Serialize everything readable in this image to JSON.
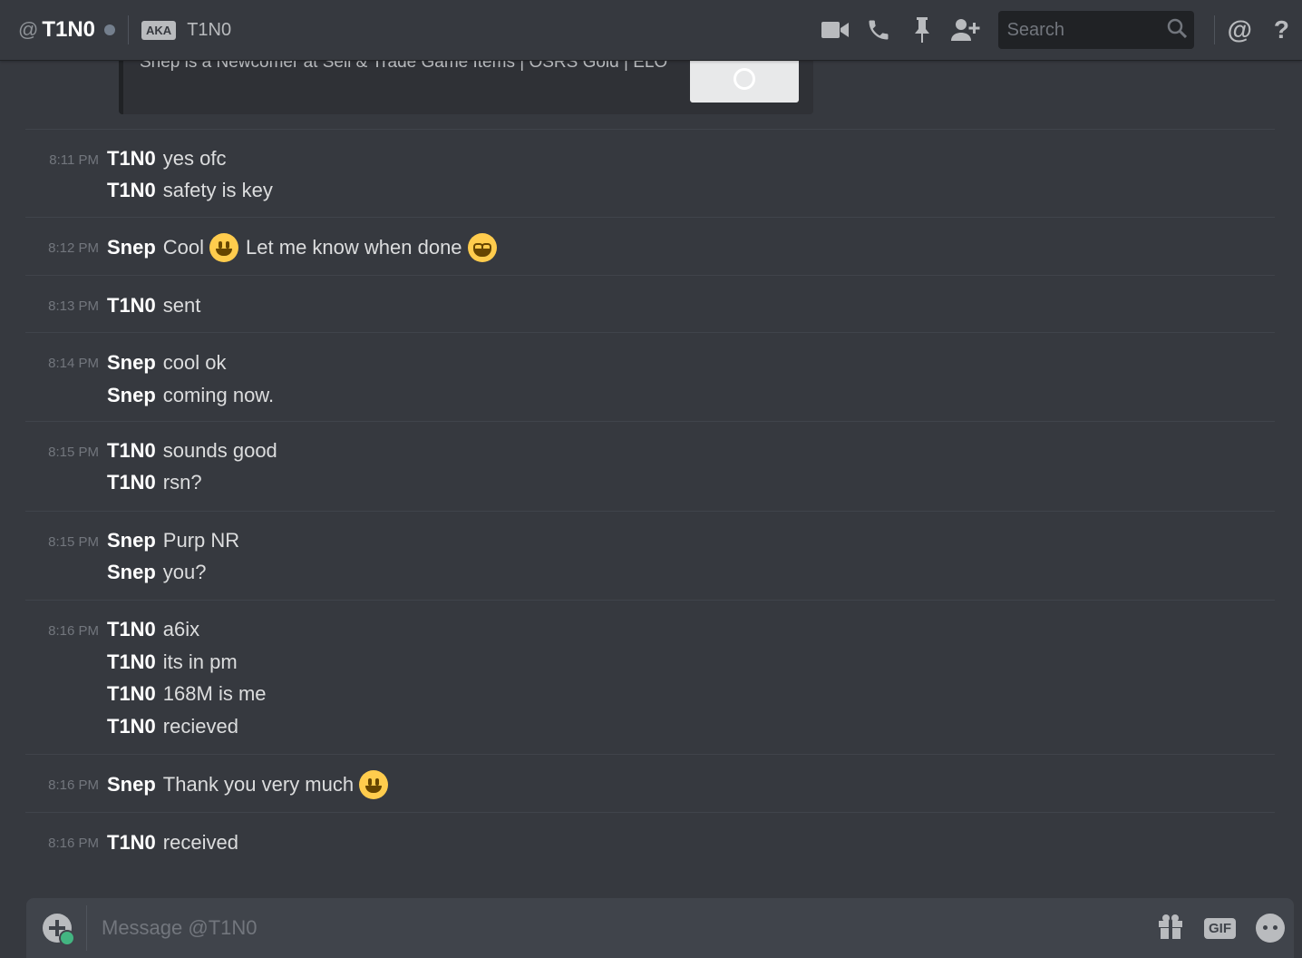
{
  "header": {
    "at": "@",
    "name": "T1N0",
    "aka_badge": "AKA",
    "aka_name": "T1N0",
    "search_placeholder": "Search",
    "mention": "@",
    "help": "?"
  },
  "embed": {
    "description": "Snep is a Newcomer at Sell & Trade Game Items | OSRS Gold | ELO"
  },
  "groups": [
    {
      "time": "8:11 PM",
      "lines": [
        {
          "author": "T1N0",
          "text": "yes ofc"
        },
        {
          "author": "T1N0",
          "text": "safety is key"
        }
      ]
    },
    {
      "time": "8:12 PM",
      "lines": [
        {
          "author": "Snep",
          "text": "Cool",
          "emoji": "smiley-emoji",
          "text2": "Let me know when done",
          "emoji2": "grin-emoji"
        }
      ]
    },
    {
      "time": "8:13 PM",
      "lines": [
        {
          "author": "T1N0",
          "text": "sent"
        }
      ]
    },
    {
      "time": "8:14 PM",
      "lines": [
        {
          "author": "Snep",
          "text": "cool ok"
        },
        {
          "author": "Snep",
          "text": "coming now."
        }
      ]
    },
    {
      "time": "8:15 PM",
      "lines": [
        {
          "author": "T1N0",
          "text": "sounds good"
        },
        {
          "author": "T1N0",
          "text": "rsn?"
        }
      ]
    },
    {
      "time": "8:15 PM",
      "lines": [
        {
          "author": "Snep",
          "text": "Purp NR"
        },
        {
          "author": "Snep",
          "text": "you?"
        }
      ]
    },
    {
      "time": "8:16 PM",
      "lines": [
        {
          "author": "T1N0",
          "text": "a6ix"
        },
        {
          "author": "T1N0",
          "text": "its in pm"
        },
        {
          "author": "T1N0",
          "text": "168M is me"
        },
        {
          "author": "T1N0",
          "text": "recieved"
        }
      ]
    },
    {
      "time": "8:16 PM",
      "lines": [
        {
          "author": "Snep",
          "text": "Thank you very much",
          "emoji": "smiley-emoji"
        }
      ]
    },
    {
      "time": "8:16 PM",
      "lines": [
        {
          "author": "T1N0",
          "text": "received"
        }
      ]
    }
  ],
  "composer": {
    "placeholder": "Message @T1N0",
    "gif_label": "GIF"
  }
}
